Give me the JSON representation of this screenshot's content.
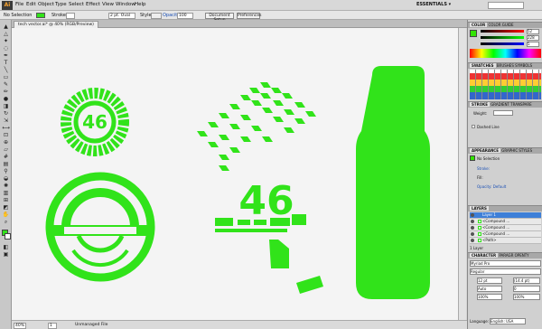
{
  "app": {
    "logo": "Ai",
    "workspace": "ESSENTIALS ▾"
  },
  "menu": [
    "File",
    "Edit",
    "Object",
    "Type",
    "Select",
    "Effect",
    "View",
    "Window",
    "Help"
  ],
  "control_bar": {
    "selection": "No Selection",
    "stroke_label": "Stroke:",
    "brush": "2 pt. Oval",
    "style_label": "Style:",
    "opacity_label": "Opacity:",
    "opacity_value": "100",
    "document_setup": "Document Setup",
    "preferences": "Preferences"
  },
  "document_tab": "tech vector.ai* @ 40% (RGB/Preview)",
  "status": {
    "zoom": "40%",
    "page": "1",
    "info": "Unmanaged File"
  },
  "panels": {
    "color": {
      "tabs": [
        "COLOR",
        "COLOR GUIDE"
      ],
      "r": "52",
      "g": "228",
      "b": "5",
      "fill": "#34e405"
    },
    "swatches": {
      "tabs": [
        "SWATCHES",
        "BRUSHES",
        "SYMBOLS"
      ]
    },
    "stroke": {
      "tabs": [
        "STROKE",
        "GRADIENT",
        "TRANSPARE"
      ],
      "weight_label": "Weight:",
      "dashed_label": "Dashed Line"
    },
    "appearance": {
      "tabs": [
        "APPEARANCE",
        "GRAPHIC STYLES"
      ],
      "title": "No Selection",
      "rows": [
        "Stroke:",
        "Fill:",
        "Opacity: Default"
      ]
    },
    "layers": {
      "tab": "LAYERS",
      "rows": [
        "Layer 1",
        "<Compound ...",
        "<Compound ...",
        "<Compound ...",
        "<Path>"
      ],
      "footer": "1 Layer"
    },
    "character": {
      "tabs": [
        "CHARACTER",
        "PARAGR",
        "OPENTY"
      ],
      "font": "Myriad Pro",
      "style": "Regular",
      "size": "12 pt",
      "leading": "(14.4 pt)",
      "kerning": "Auto",
      "tracking": "0",
      "scale_h": "100%",
      "scale_v": "100%",
      "language_label": "Language:",
      "language": "English: USA"
    }
  },
  "artwork": {
    "badge_number": "46",
    "lockup_number": "46",
    "accent": "#31e31a"
  }
}
